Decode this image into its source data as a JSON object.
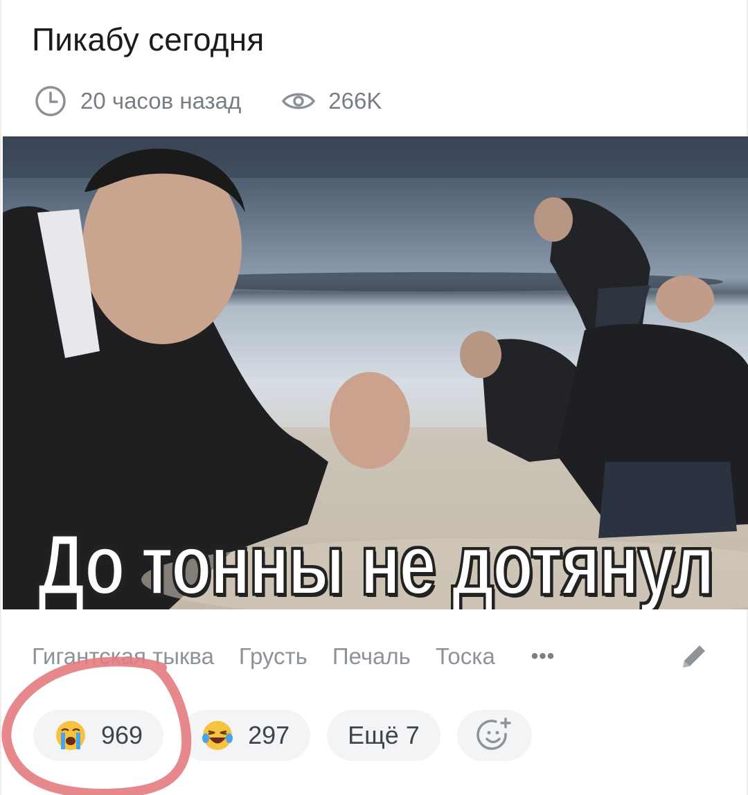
{
  "post": {
    "title": "Пикабу сегодня",
    "time_ago": "20 часов назад",
    "views": "266K",
    "image_caption": "До тонны не дотянул",
    "tags": [
      "Гигантская тыква",
      "Грусть",
      "Печаль",
      "Тоска"
    ],
    "tags_more": "•••"
  },
  "reactions": [
    {
      "emoji": "crying-face",
      "count": "969"
    },
    {
      "emoji": "laughing-face",
      "count": "297"
    }
  ],
  "reactions_more": "Ещё 7",
  "colors": {
    "text_primary": "#1b1b1b",
    "text_secondary": "#777d84",
    "pill_bg": "#f3f4f6",
    "highlight_circle": "#e37b80"
  },
  "icons": [
    "clock-icon",
    "eye-icon",
    "pencil-icon",
    "add-reaction-icon"
  ]
}
